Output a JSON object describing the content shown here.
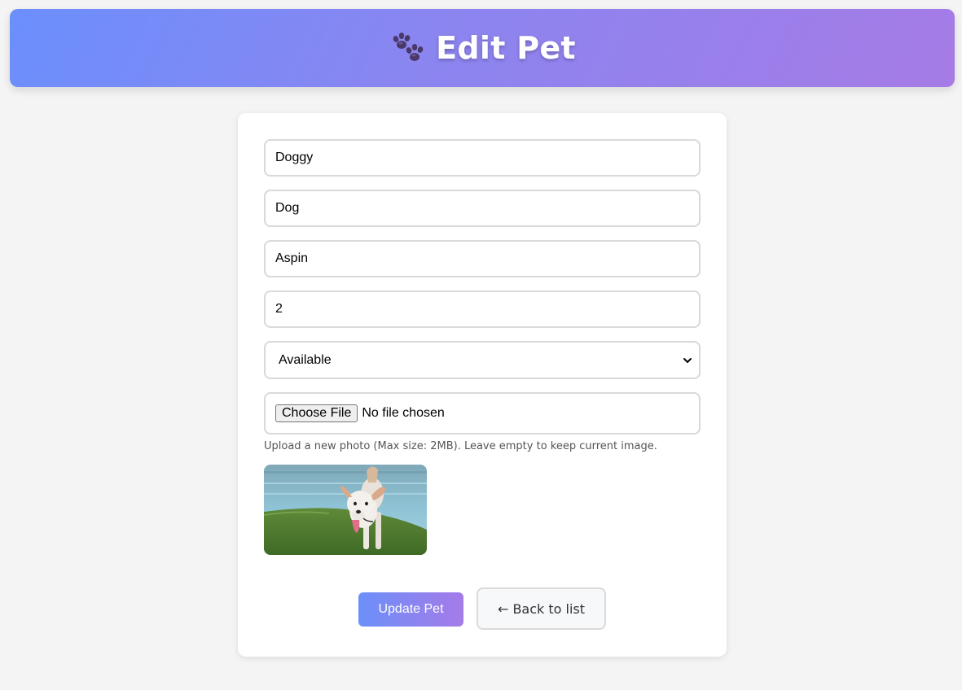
{
  "header": {
    "title": "Edit Pet",
    "icon": "paw-icon"
  },
  "form": {
    "name_value": "Doggy",
    "species_value": "Dog",
    "breed_value": "Aspin",
    "age_value": "2",
    "status_selected": "Available",
    "file_button_label": "Choose File",
    "file_status": "No file chosen",
    "upload_hint": "Upload a new photo (Max size: 2MB). Leave empty to keep current image."
  },
  "buttons": {
    "update_label": "Update Pet",
    "back_label": "← Back to list"
  },
  "colors": {
    "header_gradient_start": "#6b8ffc",
    "header_gradient_end": "#a67be6",
    "page_background": "#f4f4f4"
  }
}
